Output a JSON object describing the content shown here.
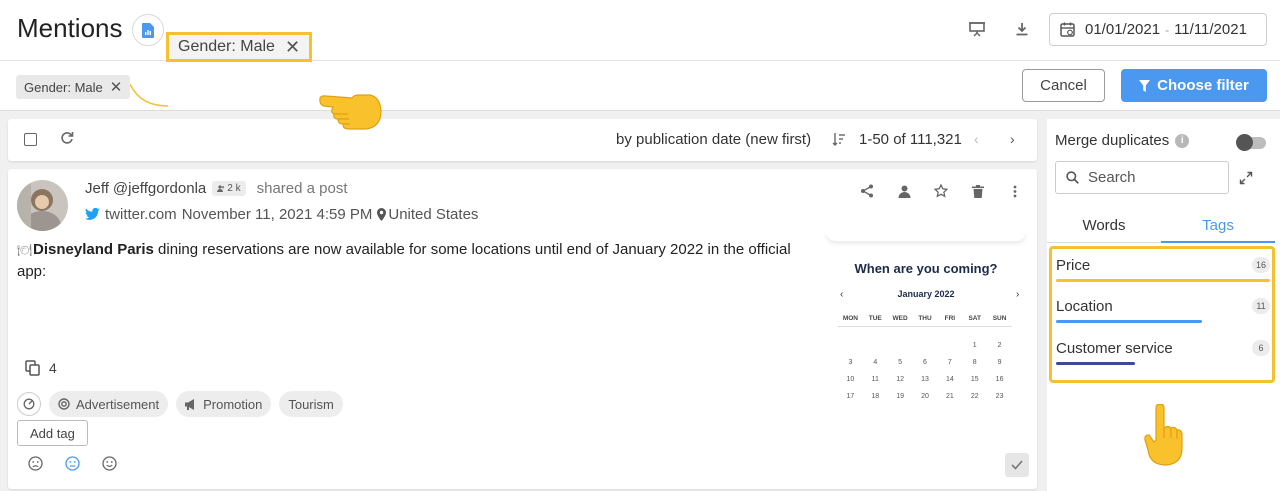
{
  "header": {
    "title": "Mentions",
    "date_from": "01/01/2021",
    "date_to": "11/11/2021"
  },
  "filters": {
    "chip_label": "Gender: Male",
    "cancel_label": "Cancel",
    "choose_label": "Choose filter"
  },
  "toolbar": {
    "sort_label": "by publication date (new first)",
    "paging": "1-50 of 111,321"
  },
  "mention": {
    "author": "Jeff",
    "handle": "@jeffgordonla",
    "followers": "2 k",
    "action": "shared a post",
    "source": "twitter.com",
    "date": "November 11, 2021 4:59 PM",
    "location": "United States",
    "text_bold": "Disneyland Paris",
    "text_rest": " dining reservations are now available for some locations until end of January 2022 in the official app:",
    "copies": "4",
    "tags": [
      "Advertisement",
      "Promotion",
      "Tourism"
    ],
    "add_tag_label": "Add tag",
    "promo": {
      "title": "When are you coming?",
      "month": "January 2022",
      "days_of_week": [
        "MON",
        "TUE",
        "WED",
        "THU",
        "FRI",
        "SAT",
        "SUN"
      ],
      "dates": [
        [
          "",
          "",
          "",
          "",
          "",
          "1",
          "2"
        ],
        [
          "3",
          "4",
          "5",
          "6",
          "7",
          "8",
          "9"
        ],
        [
          "10",
          "11",
          "12",
          "13",
          "14",
          "15",
          "16"
        ],
        [
          "17",
          "18",
          "19",
          "20",
          "21",
          "22",
          "23"
        ]
      ]
    }
  },
  "panel": {
    "merge_label": "Merge duplicates",
    "search_placeholder": "Search",
    "tab_words": "Words",
    "tab_tags": "Tags",
    "tag_items": [
      {
        "label": "Price",
        "count": "16",
        "level": 1.0,
        "color": "#f6c12e"
      },
      {
        "label": "Location",
        "count": "11",
        "level": 0.68,
        "color": "#4a98ef"
      },
      {
        "label": "Customer service",
        "count": "6",
        "level": 0.37,
        "color": "#3d4a9a"
      }
    ]
  },
  "colors": {
    "accent": "#4a98ef",
    "highlight": "#f6c12e"
  }
}
